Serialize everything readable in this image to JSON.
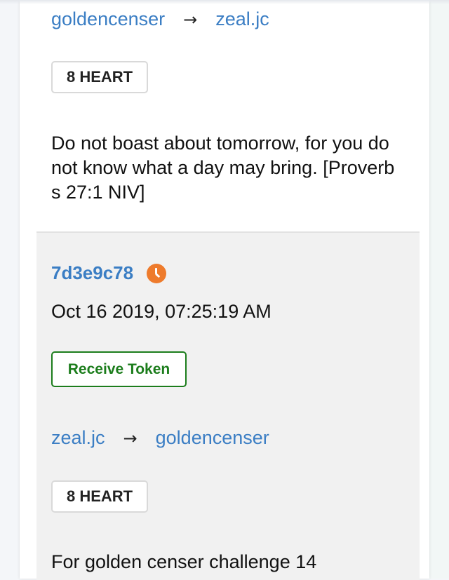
{
  "entries": [
    {
      "from": "goldencenser",
      "arrow": "→",
      "to": "zeal.jc",
      "amount_badge": "8 HEART",
      "memo": "Do not boast about tomorrow, for you do not know what a day may bring. [Proverbs 27:1 NIV]"
    },
    {
      "tx_id": "7d3e9c78",
      "timestamp": "Oct 16 2019, 07:25:19 AM",
      "operation": "Receive Token",
      "from": "zeal.jc",
      "arrow": "→",
      "to": "goldencenser",
      "amount_badge": "8 HEART",
      "memo": "For golden censer challenge 14"
    }
  ],
  "colors": {
    "link": "#3b7ec4",
    "receive_green": "#1c7d1c",
    "pending_orange": "#ee7b2c",
    "row_grey": "#f1f1f1"
  },
  "icons": {
    "status": "clock-icon"
  }
}
